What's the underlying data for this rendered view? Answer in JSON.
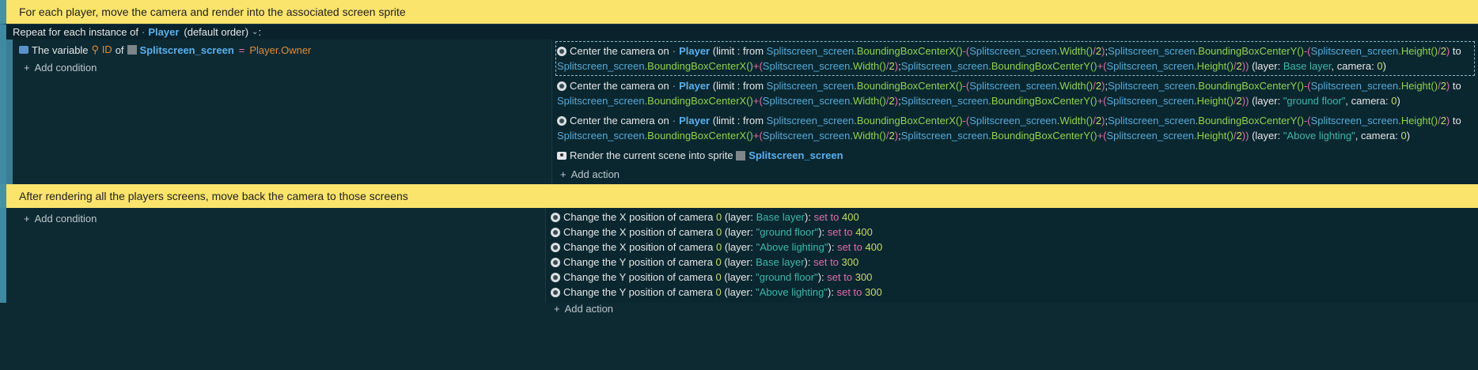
{
  "comment1": "For each player, move the camera and render into the associated screen sprite",
  "repeat": {
    "prefix": "Repeat for each instance of",
    "object": "Player",
    "suffix": "(default order)",
    "colon": ":"
  },
  "event1": {
    "condition": {
      "text_a": "The variable",
      "var": "ID",
      "text_of": "of",
      "object": "Splitscreen_screen",
      "eq": "=",
      "value": "Player.Owner"
    },
    "add_condition": "Add condition",
    "center_actions": [
      {
        "layer": "Base layer",
        "layer_kind": "lay",
        "camera": "0"
      },
      {
        "layer": "\"ground floor\"",
        "layer_kind": "str",
        "camera": "0"
      },
      {
        "layer": "\"Above lighting\"",
        "layer_kind": "str",
        "camera": "0"
      }
    ],
    "center": {
      "label": "Center the camera on",
      "object": "Player",
      "limit": "(limit : from",
      "to": "to",
      "layer_label": "(layer:",
      "camera_label": ", camera:",
      "close": ")"
    },
    "render": {
      "label": "Render the current scene into sprite",
      "object": "Splitscreen_screen"
    },
    "add_action": "Add action"
  },
  "comment2": "After rendering all the players screens, move back the camera to those screens",
  "event2": {
    "add_condition": "Add condition",
    "actions": [
      {
        "label": "Change the X position of camera",
        "camera": "0",
        "layer": "Base layer",
        "layer_kind": "lay",
        "set": "set to",
        "value": "400"
      },
      {
        "label": "Change the X position of camera",
        "camera": "0",
        "layer": "\"ground floor\"",
        "layer_kind": "str",
        "set": "set to",
        "value": "400"
      },
      {
        "label": "Change the X position of camera",
        "camera": "0",
        "layer": "\"Above lighting\"",
        "layer_kind": "str",
        "set": "set to",
        "value": "400"
      },
      {
        "label": "Change the Y position of camera",
        "camera": "0",
        "layer": "Base layer",
        "layer_kind": "lay",
        "set": "set to",
        "value": "300"
      },
      {
        "label": "Change the Y position of camera",
        "camera": "0",
        "layer": "\"ground floor\"",
        "layer_kind": "str",
        "set": "set to",
        "value": "300"
      },
      {
        "label": "Change the Y position of camera",
        "camera": "0",
        "layer": "\"Above lighting\"",
        "layer_kind": "str",
        "set": "set to",
        "value": "300"
      }
    ],
    "layer_label": "(layer:",
    "close": "):",
    "add_action": "Add action"
  }
}
